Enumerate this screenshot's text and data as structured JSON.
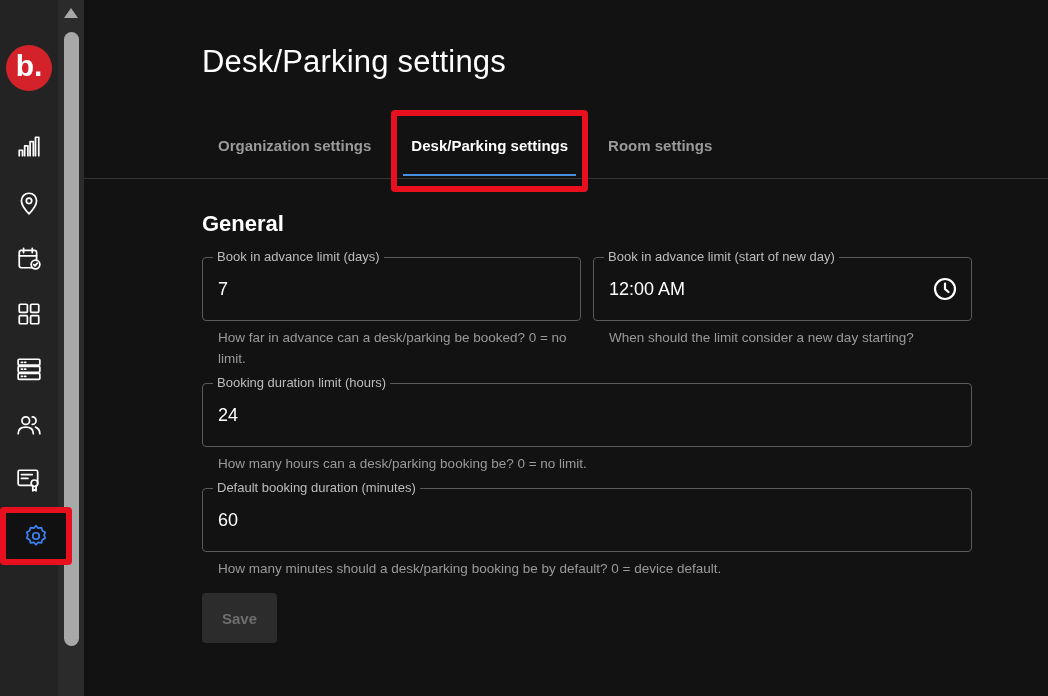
{
  "sidebar": {
    "logo": "b.",
    "items": [
      {
        "selected": false,
        "highlighted": false
      },
      {
        "selected": false,
        "highlighted": false
      },
      {
        "selected": false,
        "highlighted": false
      },
      {
        "selected": false,
        "highlighted": false
      },
      {
        "selected": false,
        "highlighted": false
      },
      {
        "selected": false,
        "highlighted": false
      },
      {
        "selected": false,
        "highlighted": false
      },
      {
        "selected": true,
        "highlighted": true
      }
    ]
  },
  "page": {
    "title": "Desk/Parking settings"
  },
  "tabs": [
    {
      "label": "Organization settings",
      "selected": false,
      "highlighted": false
    },
    {
      "label": "Desk/Parking settings",
      "selected": true,
      "highlighted": true
    },
    {
      "label": "Room settings",
      "selected": false,
      "highlighted": false
    }
  ],
  "section": {
    "title": "General"
  },
  "rows": [
    {
      "fields": [
        {
          "kind": "number",
          "label": "Book in advance limit (days)",
          "value": "7",
          "help": "How far in advance can a desk/parking be booked? 0 = no limit."
        },
        {
          "kind": "time",
          "label": "Book in advance limit (start of new day)",
          "value": "12:00 AM",
          "help": "When should the limit consider a new day starting?"
        }
      ]
    },
    {
      "fields": [
        {
          "kind": "number",
          "label": "Booking duration limit (hours)",
          "value": "24",
          "help": "How many hours can a desk/parking booking be? 0 = no limit."
        }
      ]
    },
    {
      "fields": [
        {
          "kind": "number",
          "label": "Default booking duration (minutes)",
          "value": "60",
          "help": "How many minutes should a desk/parking booking be by default? 0 = device default."
        }
      ]
    }
  ],
  "save": {
    "label": "Save",
    "disabled": true
  }
}
